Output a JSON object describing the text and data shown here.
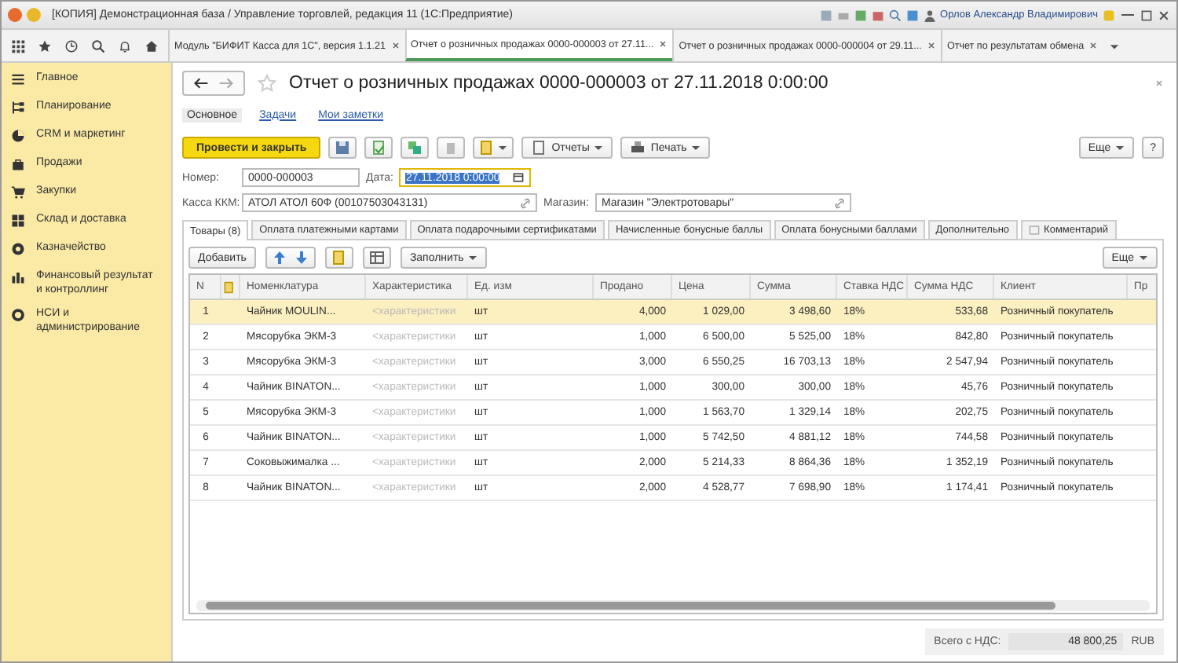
{
  "window": {
    "title": "[КОПИЯ] Демонстрационная база / Управление торговлей, редакция 11  (1С:Предприятие)",
    "user": "Орлов Александр Владимирович"
  },
  "tabs": [
    {
      "label": "Модуль \"БИФИТ Касса для 1С\", версия 1.1.21",
      "selected": false
    },
    {
      "label": "Отчет о розничных продажах 0000-000003 от 27.11...",
      "selected": true
    },
    {
      "label": "Отчет о розничных продажах 0000-000004 от 29.11...",
      "selected": false
    },
    {
      "label": "Отчет по результатам обмена",
      "selected": false
    }
  ],
  "sidebar": {
    "items": [
      {
        "label": "Главное"
      },
      {
        "label": "Планирование"
      },
      {
        "label": "CRM и маркетинг"
      },
      {
        "label": "Продажи"
      },
      {
        "label": "Закупки"
      },
      {
        "label": "Склад и доставка"
      },
      {
        "label": "Казначейство"
      },
      {
        "label": "Финансовый результат и контроллинг"
      },
      {
        "label": "НСИ и администрирование"
      }
    ]
  },
  "document": {
    "title": "Отчет о розничных продажах 0000-000003 от 27.11.2018 0:00:00",
    "subtabs": [
      {
        "label": "Основное",
        "selected": true
      },
      {
        "label": "Задачи",
        "selected": false
      },
      {
        "label": "Мои заметки",
        "selected": false
      }
    ],
    "post_button": "Провести и закрыть",
    "reports_button": "Отчеты",
    "print_button": "Печать",
    "more_button": "Еще",
    "help_button": "?",
    "number_label": "Номер:",
    "number": "0000-000003",
    "date_label": "Дата:",
    "date": "27.11.2018  0:00:00",
    "kkm_label": "Касса ККМ:",
    "kkm": "АТОЛ АТОЛ 60Ф (00107503043131)",
    "store_label": "Магазин:",
    "store": "Магазин \"Электротовары\""
  },
  "section_tabs": [
    {
      "label": "Товары (8)",
      "selected": true
    },
    {
      "label": "Оплата платежными картами",
      "selected": false
    },
    {
      "label": "Оплата подарочными сертификатами",
      "selected": false
    },
    {
      "label": "Начисленные бонусные баллы",
      "selected": false
    },
    {
      "label": "Оплата бонусными баллами",
      "selected": false
    },
    {
      "label": "Дополнительно",
      "selected": false
    },
    {
      "label": "Комментарий",
      "selected": false
    }
  ],
  "table_toolbar": {
    "add_button": "Добавить",
    "fill_button": "Заполнить",
    "more_button": "Еще"
  },
  "table": {
    "columns": [
      "N",
      "Номенклатура",
      "Характеристика",
      "Ед. изм",
      "Продано",
      "Цена",
      "Сумма",
      "Ставка НДС",
      "Сумма НДС",
      "Клиент",
      "Пр"
    ],
    "rows": [
      {
        "selected": true,
        "cells": [
          "1",
          "Чайник MOULIN...",
          "<характеристики",
          "шт",
          "4,000",
          "1 029,00",
          "3 498,60",
          "18%",
          "533,68",
          "Розничный покупатель"
        ]
      },
      {
        "selected": false,
        "cells": [
          "2",
          "Мясорубка ЭКМ-3",
          "<характеристики",
          "шт",
          "1,000",
          "6 500,00",
          "5 525,00",
          "18%",
          "842,80",
          "Розничный покупатель"
        ]
      },
      {
        "selected": false,
        "cells": [
          "3",
          "Мясорубка ЭКМ-3",
          "<характеристики",
          "шт",
          "3,000",
          "6 550,25",
          "16 703,13",
          "18%",
          "2 547,94",
          "Розничный покупатель"
        ]
      },
      {
        "selected": false,
        "cells": [
          "4",
          "Чайник BINATON...",
          "<характеристики",
          "шт",
          "1,000",
          "300,00",
          "300,00",
          "18%",
          "45,76",
          "Розничный покупатель"
        ]
      },
      {
        "selected": false,
        "cells": [
          "5",
          "Мясорубка ЭКМ-3",
          "<характеристики",
          "шт",
          "1,000",
          "1 563,70",
          "1 329,14",
          "18%",
          "202,75",
          "Розничный покупатель"
        ]
      },
      {
        "selected": false,
        "cells": [
          "6",
          "Чайник BINATON...",
          "<характеристики",
          "шт",
          "1,000",
          "5 742,50",
          "4 881,12",
          "18%",
          "744,58",
          "Розничный покупатель"
        ]
      },
      {
        "selected": false,
        "cells": [
          "7",
          "Соковыжималка ...",
          "<характеристики",
          "шт",
          "2,000",
          "5 214,33",
          "8 864,36",
          "18%",
          "1 352,19",
          "Розничный покупатель"
        ]
      },
      {
        "selected": false,
        "cells": [
          "8",
          "Чайник BINATON...",
          "<характеристики",
          "шт",
          "2,000",
          "4 528,77",
          "7 698,90",
          "18%",
          "1 174,41",
          "Розничный покупатель"
        ]
      }
    ]
  },
  "footer": {
    "total_label": "Всего с НДС:",
    "total": "48 800,25",
    "currency": "RUB"
  }
}
